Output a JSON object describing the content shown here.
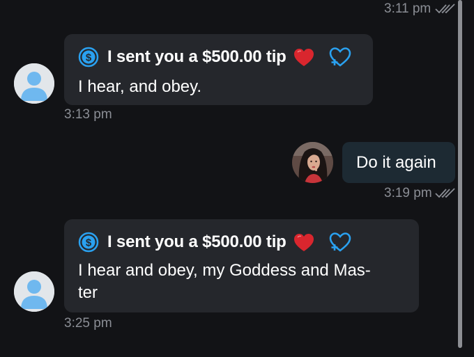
{
  "timestamps": {
    "first": "3:11 pm",
    "second": "3:13 pm",
    "third": "3:19 pm",
    "fourth": "3:25 pm"
  },
  "messages": [
    {
      "tip_text": "I sent you a $500.00 tip",
      "text": "I hear, and obey."
    },
    {
      "text": "Do it again"
    },
    {
      "tip_text": "I sent you a $500.00 tip",
      "text_line1": "I hear and obey, my Goddess and Mas-",
      "text_line2": "ter"
    }
  ],
  "icons": {
    "tip": "dollar-circle-icon",
    "heart": "red-heart-icon",
    "react": "heart-reaction-icon",
    "read": "double-check-icon",
    "avatar": "default-user-avatar"
  },
  "colors": {
    "background": "#121316",
    "incoming_bubble": "#25272c",
    "outgoing_bubble": "#1d2a33",
    "accent": "#2aa1f0",
    "heart": "#d9262e",
    "timestamp": "#8b8e95"
  }
}
